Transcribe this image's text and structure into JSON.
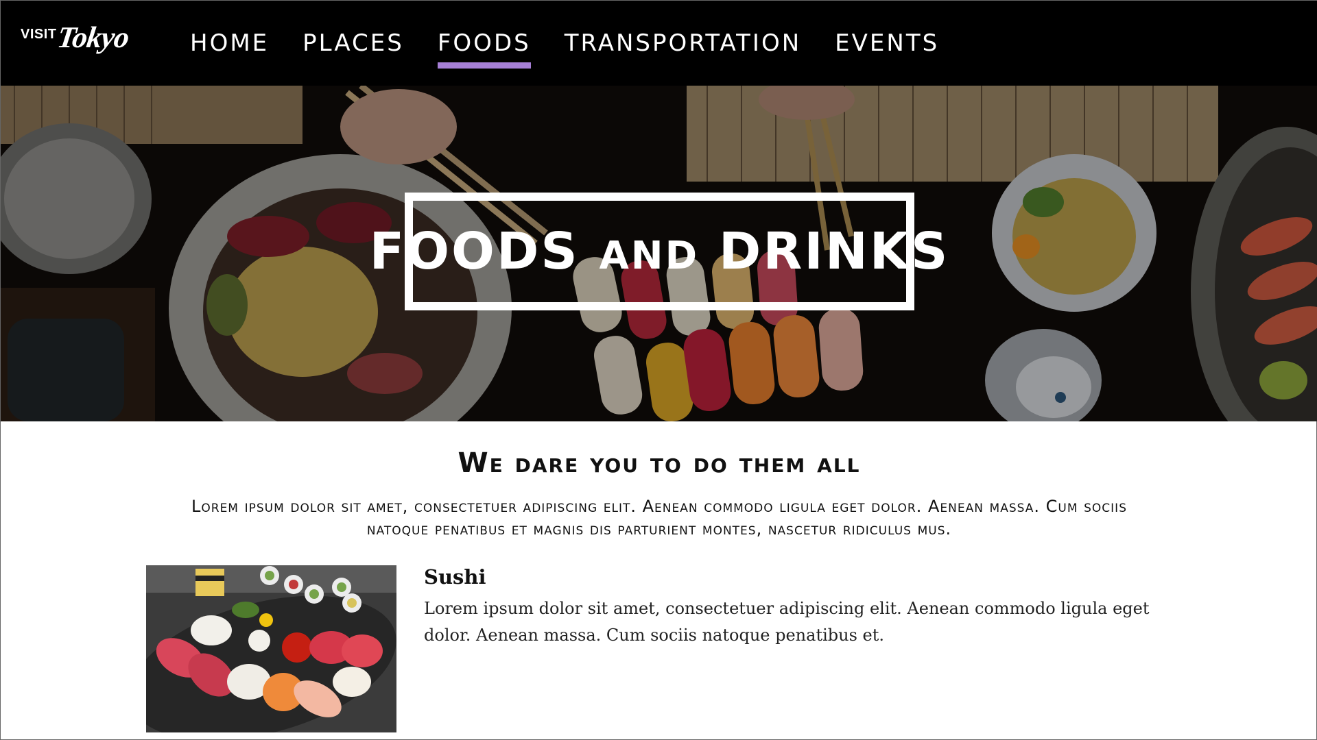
{
  "logo": {
    "visit": "VISIT",
    "city": "Tokyo"
  },
  "nav": {
    "items": [
      {
        "label": "HOME"
      },
      {
        "label": "PLACES"
      },
      {
        "label": "FOODS",
        "active": true
      },
      {
        "label": "TRANSPORTATION"
      },
      {
        "label": "EVENTS"
      }
    ]
  },
  "hero": {
    "title_a": "FOODS ",
    "title_b": "AND",
    "title_c": " DRINKS"
  },
  "section": {
    "heading": "We dare you to do them all",
    "intro": "Lorem ipsum dolor sit amet, consectetuer adipiscing elit. Aenean commodo ligula eget dolor. Aenean massa. Cum sociis natoque penatibus et magnis dis parturient montes, nascetur ridiculus mus."
  },
  "foods": [
    {
      "name": "Sushi",
      "description": "Lorem ipsum dolor sit amet, consectetuer adipiscing elit. Aenean commodo ligula eget dolor. Aenean massa. Cum sociis natoque penatibus et."
    }
  ],
  "colors": {
    "nav_bg": "#000000",
    "accent": "#a67fd6",
    "text": "#111111"
  }
}
